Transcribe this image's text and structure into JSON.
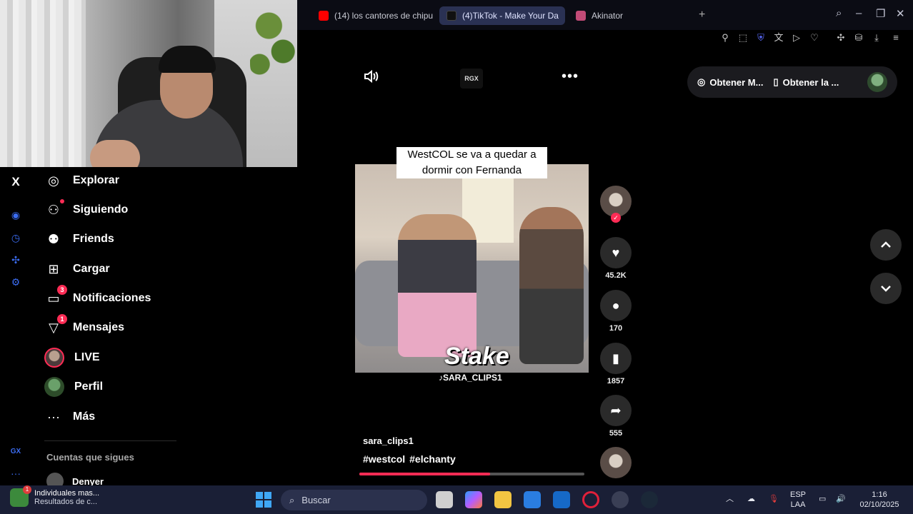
{
  "browser": {
    "tabs": [
      {
        "label": "(14) los cantores de chipu",
        "active": false,
        "favicon_color": "#ff0000"
      },
      {
        "label": "(4)TikTok - Make Your Da",
        "active": true,
        "favicon_color": "#111111"
      },
      {
        "label": "Akinator",
        "active": false,
        "favicon_color": "#c24b77"
      }
    ],
    "new_tab": "+"
  },
  "sidebar": {
    "close": "X",
    "items": [
      {
        "label": "Explorar",
        "icon": "compass-icon"
      },
      {
        "label": "Siguiendo",
        "icon": "following-icon"
      },
      {
        "label": "Friends",
        "icon": "friends-icon"
      },
      {
        "label": "Cargar",
        "icon": "upload-icon"
      },
      {
        "label": "Notificaciones",
        "icon": "inbox-icon",
        "badge": "3"
      },
      {
        "label": "Mensajes",
        "icon": "send-icon",
        "badge": "1"
      },
      {
        "label": "LIVE",
        "icon": "live-avatar"
      },
      {
        "label": "Perfil",
        "icon": "profile-avatar"
      },
      {
        "label": "Más",
        "icon": "more-icon"
      }
    ],
    "following_title": "Cuentas que sigues",
    "following": [
      {
        "name": "Denyer"
      }
    ],
    "rail_gx": "GX",
    "rail_more": "···"
  },
  "video": {
    "rgx_label": "RGX",
    "caption": "WestCOL se va a quedar a dormir con Fernanda",
    "brand": "Stake",
    "watermark": "♪SARA_CLIPS1",
    "author": "sara_clips1",
    "tags": [
      "#westcol",
      "#elchanty"
    ],
    "progress": 0.58,
    "likes": "45.2K",
    "comments": "170",
    "saves": "1857",
    "shares": "555"
  },
  "header_actions": {
    "get_coins": "Obtener M...",
    "get_app": "Obtener la ..."
  },
  "taskbar": {
    "notification_title": "Individuales mas...",
    "notification_sub": "Resultados de c...",
    "notification_badge": "1",
    "search_placeholder": "Buscar",
    "lang_top": "ESP",
    "lang_bottom": "LAA",
    "time": "1:16",
    "date": "02/10/2025"
  }
}
